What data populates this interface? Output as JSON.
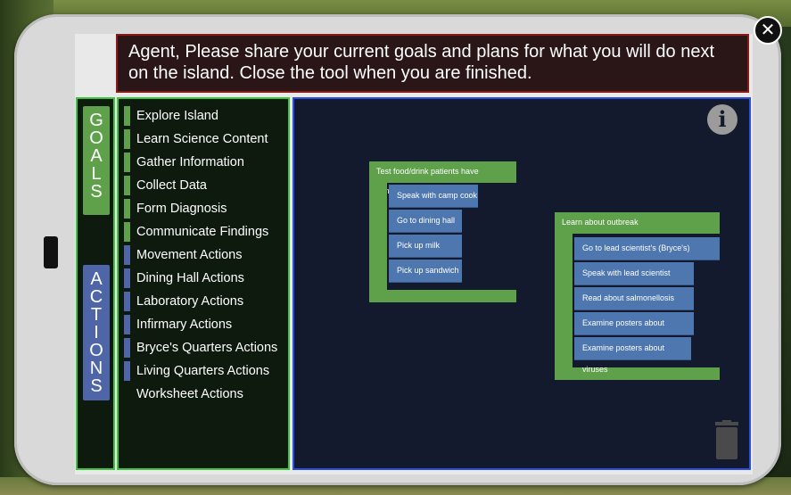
{
  "prompt": {
    "text": "Agent, Please share your current goals and plans for what you will do next on the island. Close the tool when you are finished."
  },
  "tabs": {
    "goals": [
      "G",
      "O",
      "A",
      "L",
      "S"
    ],
    "actions": [
      "A",
      "C",
      "T",
      "I",
      "O",
      "N",
      "S"
    ]
  },
  "colors": {
    "goal_green": "#5fa04b",
    "action_blue": "#4e77b0",
    "panel_border_green": "#3ec43e",
    "canvas_border_blue": "#2a4fe0",
    "prompt_border_red": "#8a1a1a"
  },
  "list": {
    "items": [
      {
        "label": "Explore Island",
        "type": "goal"
      },
      {
        "label": "Learn Science Content",
        "type": "goal"
      },
      {
        "label": "Gather Information",
        "type": "goal"
      },
      {
        "label": "Collect Data",
        "type": "goal"
      },
      {
        "label": "Form Diagnosis",
        "type": "goal"
      },
      {
        "label": "Communicate Findings",
        "type": "goal"
      },
      {
        "label": "Movement Actions",
        "type": "action"
      },
      {
        "label": "Dining Hall Actions",
        "type": "action"
      },
      {
        "label": "Laboratory Actions",
        "type": "action"
      },
      {
        "label": "Infirmary Actions",
        "type": "action"
      },
      {
        "label": "Bryce's Quarters Actions",
        "type": "action"
      },
      {
        "label": "Living Quarters Actions",
        "type": "action"
      },
      {
        "label": "Worksheet Actions",
        "type": "none"
      }
    ]
  },
  "canvas": {
    "goal1": {
      "title": "Test food/drink patients have consumed",
      "actions": [
        "Speak with camp cook",
        "Go to dining hall",
        "Pick up milk",
        "Pick up sandwich"
      ]
    },
    "goal2": {
      "title": "Learn about outbreak",
      "actions": [
        "Go to lead scientist's (Bryce's) quarters",
        "Speak with lead scientist",
        "Read about salmonellosis",
        "Examine posters about bacteria",
        "Examine posters about viruses"
      ]
    },
    "info_icon": "info-icon",
    "trash_icon": "trash-icon"
  },
  "close_icon": "close-icon"
}
